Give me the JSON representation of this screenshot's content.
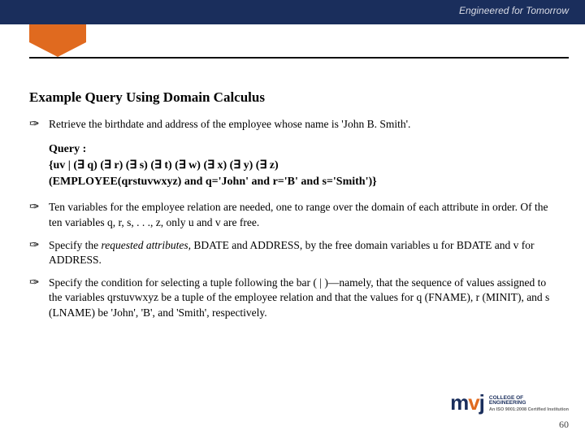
{
  "header": {
    "tagline": "Engineered for Tomorrow"
  },
  "title": "Example Query Using Domain Calculus",
  "intro": "Retrieve the birthdate and address of the employee whose name is 'John B. Smith'.",
  "query": {
    "label": "Query :",
    "line1": "{uv | (∃ q) (∃ r) (∃ s) (∃ t) (∃ w) (∃ x) (∃ y) (∃ z)",
    "line2": "(EMPLOYEE(qrstuvwxyz) and q='John' and r='B' and s='Smith')}"
  },
  "bullets": [
    "Ten variables for the employee relation are needed, one to range over the domain of each attribute in order. Of the ten variables q, r, s, . . ., z, only u and v are free.",
    "Specify the requested attributes, BDATE and ADDRESS, by the free domain variables u for BDATE and v for ADDRESS.",
    "Specify the condition for selecting a tuple following the bar ( | )—namely, that the sequence of values assigned to the variables qrstuvwxyz be a tuple of the employee relation and that the values for q (FNAME), r (MINIT), and s (LNAME) be 'John', 'B', and 'Smith', respectively."
  ],
  "footer": {
    "logo1": "m",
    "logo2": "v",
    "logo3": "j",
    "college1": "COLLEGE OF",
    "college2": "ENGINEERING",
    "iso": "An ISO 9001:2008 Certified Institution",
    "page": "60"
  },
  "bullet_glyph": "✑",
  "italic_word": "requested attributes,"
}
